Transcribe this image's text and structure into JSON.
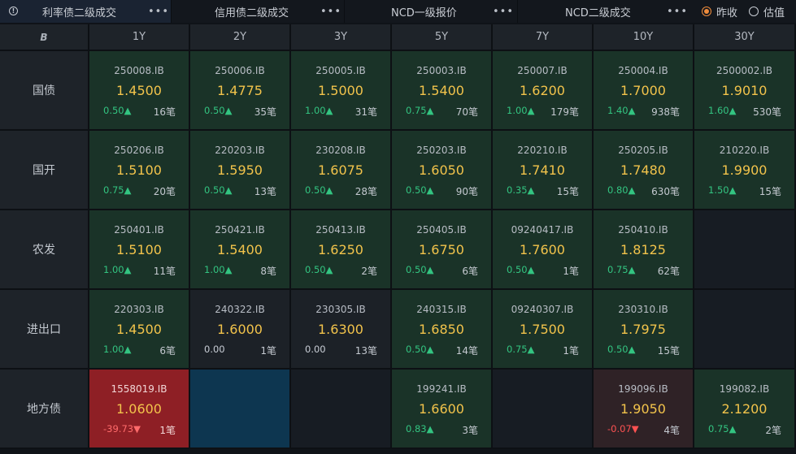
{
  "tabs": [
    {
      "label": "利率债二级成交",
      "active": true,
      "menu": "•••"
    },
    {
      "label": "信用债二级成交",
      "active": false,
      "menu": "•••"
    },
    {
      "label": "NCD一级报价",
      "active": false,
      "menu": "•••"
    },
    {
      "label": "NCD二级成交",
      "active": false,
      "menu": "•••"
    }
  ],
  "radio": {
    "option1": "昨收",
    "option2": "估值",
    "selected": "option1"
  },
  "grid": {
    "corner_glyph": "B",
    "tenors": [
      "1Y",
      "2Y",
      "3Y",
      "5Y",
      "7Y",
      "10Y",
      "30Y"
    ],
    "rows": [
      {
        "label": "国债",
        "cells": [
          {
            "style": "c-green",
            "code": "250008.IB",
            "yield": "1.4500",
            "change": "0.50▲",
            "dir": "up",
            "count": "16笔"
          },
          {
            "style": "c-green",
            "code": "250006.IB",
            "yield": "1.4775",
            "change": "0.50▲",
            "dir": "up",
            "count": "35笔"
          },
          {
            "style": "c-green",
            "code": "250005.IB",
            "yield": "1.5000",
            "change": "1.00▲",
            "dir": "up",
            "count": "31笔"
          },
          {
            "style": "c-green",
            "code": "250003.IB",
            "yield": "1.5400",
            "change": "0.75▲",
            "dir": "up",
            "count": "70笔"
          },
          {
            "style": "c-green",
            "code": "250007.IB",
            "yield": "1.6200",
            "change": "1.00▲",
            "dir": "up",
            "count": "179笔"
          },
          {
            "style": "c-green",
            "code": "250004.IB",
            "yield": "1.7000",
            "change": "1.40▲",
            "dir": "up",
            "count": "938笔"
          },
          {
            "style": "c-green",
            "code": "2500002.IB",
            "yield": "1.9010",
            "change": "1.60▲",
            "dir": "up",
            "count": "530笔"
          }
        ]
      },
      {
        "label": "国开",
        "cells": [
          {
            "style": "c-green",
            "code": "250206.IB",
            "yield": "1.5100",
            "change": "0.75▲",
            "dir": "up",
            "count": "20笔"
          },
          {
            "style": "c-green",
            "code": "220203.IB",
            "yield": "1.5950",
            "change": "0.50▲",
            "dir": "up",
            "count": "13笔"
          },
          {
            "style": "c-green",
            "code": "230208.IB",
            "yield": "1.6075",
            "change": "0.50▲",
            "dir": "up",
            "count": "28笔"
          },
          {
            "style": "c-green",
            "code": "250203.IB",
            "yield": "1.6050",
            "change": "0.50▲",
            "dir": "up",
            "count": "90笔"
          },
          {
            "style": "c-green",
            "code": "220210.IB",
            "yield": "1.7410",
            "change": "0.35▲",
            "dir": "up",
            "count": "15笔"
          },
          {
            "style": "c-green",
            "code": "250205.IB",
            "yield": "1.7480",
            "change": "0.80▲",
            "dir": "up",
            "count": "630笔"
          },
          {
            "style": "c-green",
            "code": "210220.IB",
            "yield": "1.9900",
            "change": "1.50▲",
            "dir": "up",
            "count": "15笔"
          }
        ]
      },
      {
        "label": "农发",
        "cells": [
          {
            "style": "c-green",
            "code": "250401.IB",
            "yield": "1.5100",
            "change": "1.00▲",
            "dir": "up",
            "count": "11笔"
          },
          {
            "style": "c-green",
            "code": "250421.IB",
            "yield": "1.5400",
            "change": "1.00▲",
            "dir": "up",
            "count": "8笔"
          },
          {
            "style": "c-green",
            "code": "250413.IB",
            "yield": "1.6250",
            "change": "0.50▲",
            "dir": "up",
            "count": "2笔"
          },
          {
            "style": "c-green",
            "code": "250405.IB",
            "yield": "1.6750",
            "change": "0.50▲",
            "dir": "up",
            "count": "6笔"
          },
          {
            "style": "c-green",
            "code": "09240417.IB",
            "yield": "1.7600",
            "change": "0.50▲",
            "dir": "up",
            "count": "1笔"
          },
          {
            "style": "c-green",
            "code": "250410.IB",
            "yield": "1.8125",
            "change": "0.75▲",
            "dir": "up",
            "count": "62笔"
          },
          {
            "style": "c-empty",
            "code": "",
            "yield": "",
            "change": "",
            "dir": "",
            "count": ""
          }
        ]
      },
      {
        "label": "进出口",
        "cells": [
          {
            "style": "c-green",
            "code": "220303.IB",
            "yield": "1.4500",
            "change": "1.00▲",
            "dir": "up",
            "count": "6笔"
          },
          {
            "style": "c-dark",
            "code": "240322.IB",
            "yield": "1.6000",
            "change": "0.00",
            "dir": "flat",
            "count": "1笔"
          },
          {
            "style": "c-dark",
            "code": "230305.IB",
            "yield": "1.6300",
            "change": "0.00",
            "dir": "flat",
            "count": "13笔"
          },
          {
            "style": "c-green",
            "code": "240315.IB",
            "yield": "1.6850",
            "change": "0.50▲",
            "dir": "up",
            "count": "14笔"
          },
          {
            "style": "c-green",
            "code": "09240307.IB",
            "yield": "1.7500",
            "change": "0.75▲",
            "dir": "up",
            "count": "1笔"
          },
          {
            "style": "c-green",
            "code": "230310.IB",
            "yield": "1.7975",
            "change": "0.50▲",
            "dir": "up",
            "count": "15笔"
          },
          {
            "style": "c-empty",
            "code": "",
            "yield": "",
            "change": "",
            "dir": "",
            "count": ""
          }
        ]
      },
      {
        "label": "地方债",
        "cells": [
          {
            "style": "c-red",
            "code": "1558019.IB",
            "yield": "1.0600",
            "change": "-39.73▼",
            "dir": "down",
            "count": "1笔"
          },
          {
            "style": "c-blue",
            "code": "",
            "yield": "",
            "change": "",
            "dir": "",
            "count": ""
          },
          {
            "style": "c-empty",
            "code": "",
            "yield": "",
            "change": "",
            "dir": "",
            "count": ""
          },
          {
            "style": "c-green",
            "code": "199241.IB",
            "yield": "1.6600",
            "change": "0.83▲",
            "dir": "up",
            "count": "3笔"
          },
          {
            "style": "c-empty",
            "code": "",
            "yield": "",
            "change": "",
            "dir": "",
            "count": ""
          },
          {
            "style": "c-darkred",
            "code": "199096.IB",
            "yield": "1.9050",
            "change": "-0.07▼",
            "dir": "down",
            "count": "4笔"
          },
          {
            "style": "c-green",
            "code": "199082.IB",
            "yield": "2.1200",
            "change": "0.75▲",
            "dir": "up",
            "count": "2笔"
          }
        ]
      }
    ]
  }
}
